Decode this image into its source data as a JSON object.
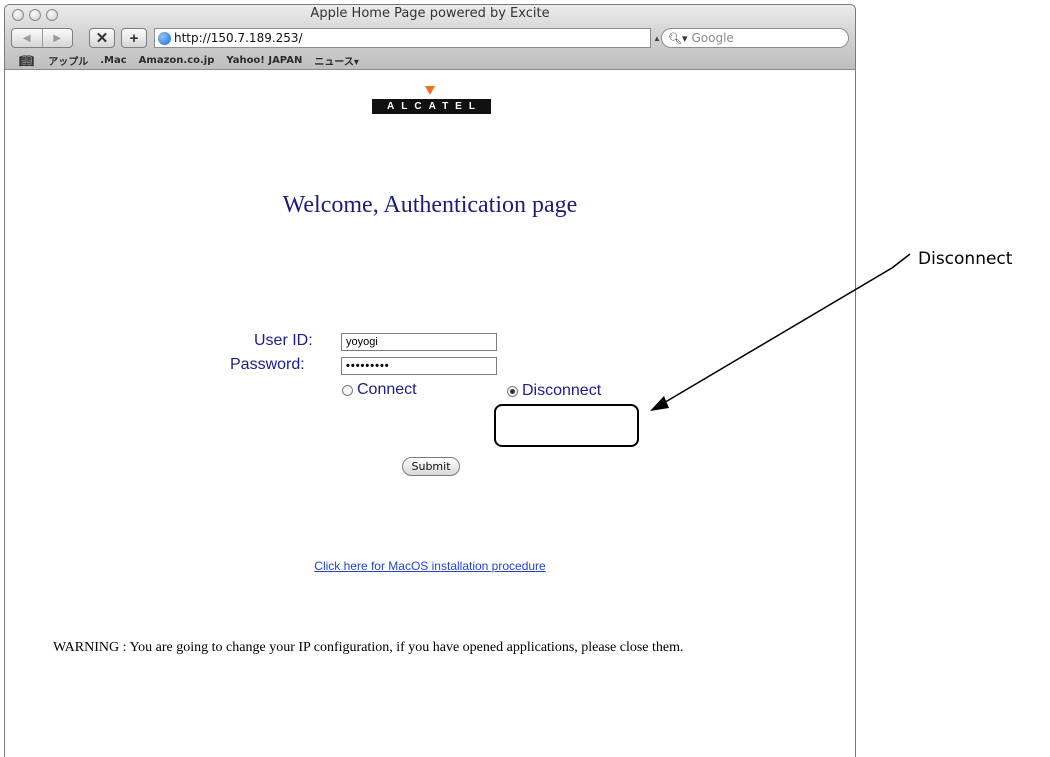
{
  "window": {
    "title": "Apple Home Page powered by Excite",
    "url": "http://150.7.189.253/",
    "search_placeholder": "Google"
  },
  "bookmarks": [
    "アップル",
    ".Mac",
    "Amazon.co.jp",
    "Yahoo! JAPAN",
    "ニュース▾"
  ],
  "page": {
    "logo_text": "ALCATEL",
    "heading": "Welcome, Authentication page",
    "user_id_label": "User ID:",
    "user_id_value": "yoyogi",
    "password_label": "Password:",
    "password_value": "•••••••••",
    "connect_label": "Connect",
    "disconnect_label": "Disconnect",
    "selected_option": "Disconnect",
    "submit_label": "Submit",
    "link_text": "Click here for MacOS installation procedure",
    "warning_text": "WARNING : You are going to change your IP configuration, if you have opened applications, please close them."
  },
  "annotation": {
    "label": "Disconnect"
  },
  "colors": {
    "heading": "#1c1c7a",
    "link": "#2244cc",
    "logo_triangle": "#f26f21"
  }
}
